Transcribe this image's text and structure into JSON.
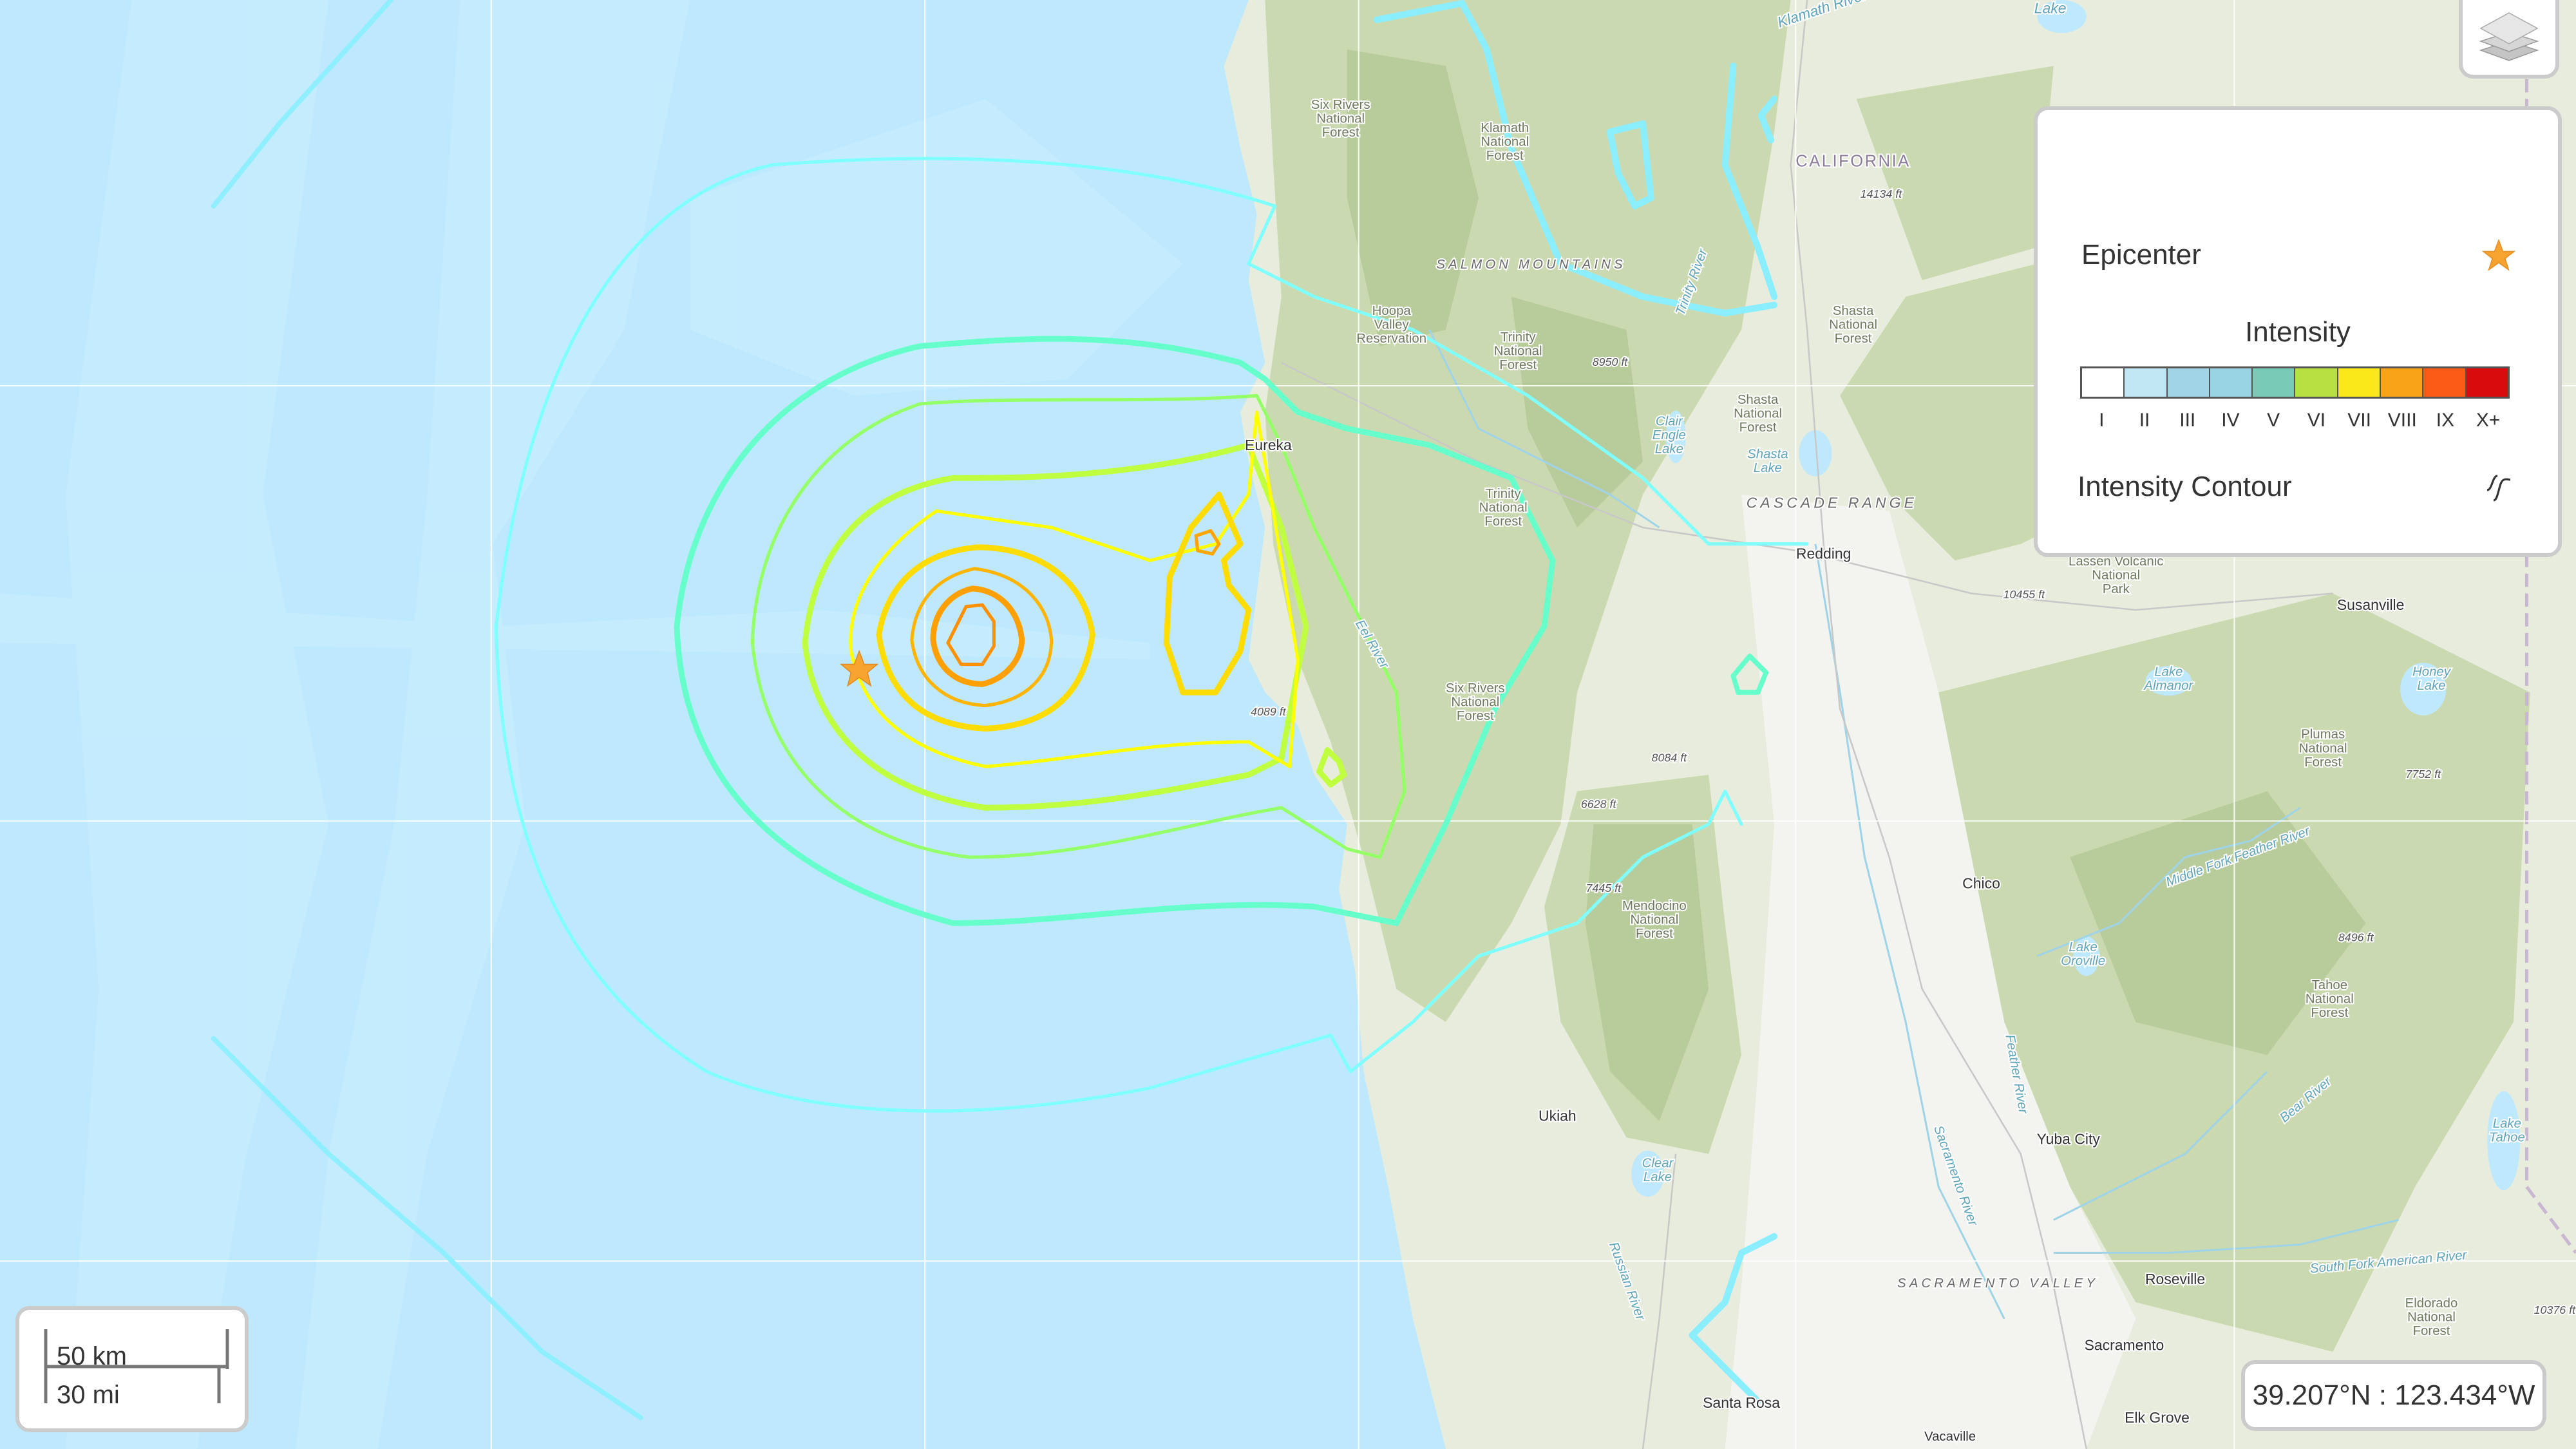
{
  "map": {
    "type": "USGS ShakeMap intensity contours",
    "epicenter": {
      "label": "Epicenter",
      "icon": "star-icon",
      "color": "#f7a330"
    },
    "contour_colors": {
      "III": "#a0e6ff",
      "IV": "#80ffff",
      "V": "#7affc8",
      "VI": "#b8ff40",
      "VI_5": "#ffff00",
      "VII": "#ffdc00",
      "VII_5": "#ffc000",
      "VIII": "#ff9900"
    },
    "place_labels": [
      {
        "text": "Klamath River",
        "kind": "river"
      },
      {
        "text": "Lake",
        "kind": "water"
      },
      {
        "text": "Six Rivers National Forest",
        "kind": "forest"
      },
      {
        "text": "Klamath National Forest",
        "kind": "forest"
      },
      {
        "text": "CALIFORNIA",
        "kind": "state"
      },
      {
        "text": "14134 ft",
        "kind": "elevation"
      },
      {
        "text": "SALMON MOUNTAINS",
        "kind": "range"
      },
      {
        "text": "Trinity River",
        "kind": "river"
      },
      {
        "text": "Hoopa Valley Reservation",
        "kind": "reservation"
      },
      {
        "text": "Trinity National Forest",
        "kind": "forest"
      },
      {
        "text": "8950 ft",
        "kind": "elevation"
      },
      {
        "text": "Shasta National Forest",
        "kind": "forest"
      },
      {
        "text": "Shasta National Forest",
        "kind": "forest"
      },
      {
        "text": "Eureka",
        "kind": "city"
      },
      {
        "text": "Clair Engle Lake",
        "kind": "water"
      },
      {
        "text": "Shasta Lake",
        "kind": "water"
      },
      {
        "text": "CASCADE RANGE",
        "kind": "range"
      },
      {
        "text": "Trinity National Forest",
        "kind": "forest"
      },
      {
        "text": "Redding",
        "kind": "city"
      },
      {
        "text": "Lassen Volcanic National Park",
        "kind": "park"
      },
      {
        "text": "10455 ft",
        "kind": "elevation"
      },
      {
        "text": "Susanville",
        "kind": "city"
      },
      {
        "text": "Lake Almanor",
        "kind": "water"
      },
      {
        "text": "Honey Lake",
        "kind": "water"
      },
      {
        "text": "Eel River",
        "kind": "river"
      },
      {
        "text": "4089 ft",
        "kind": "elevation"
      },
      {
        "text": "Six Rivers National Forest",
        "kind": "forest"
      },
      {
        "text": "Plumas National Forest",
        "kind": "forest"
      },
      {
        "text": "8084 ft",
        "kind": "elevation"
      },
      {
        "text": "7752 ft",
        "kind": "elevation"
      },
      {
        "text": "6628 ft",
        "kind": "elevation"
      },
      {
        "text": "Middle Fork Feather River",
        "kind": "river"
      },
      {
        "text": "7445 ft",
        "kind": "elevation"
      },
      {
        "text": "Chico",
        "kind": "city"
      },
      {
        "text": "Mendocino National Forest",
        "kind": "forest"
      },
      {
        "text": "8496 ft",
        "kind": "elevation"
      },
      {
        "text": "Lake Oroville",
        "kind": "water"
      },
      {
        "text": "Tahoe National Forest",
        "kind": "forest"
      },
      {
        "text": "Feather River",
        "kind": "river"
      },
      {
        "text": "Bear River",
        "kind": "river"
      },
      {
        "text": "Ukiah",
        "kind": "city"
      },
      {
        "text": "Lake Tahoe",
        "kind": "water"
      },
      {
        "text": "Yuba City",
        "kind": "city"
      },
      {
        "text": "Sacramento River",
        "kind": "river"
      },
      {
        "text": "Clear Lake",
        "kind": "water"
      },
      {
        "text": "Russian River",
        "kind": "river"
      },
      {
        "text": "SACRAMENTO VALLEY",
        "kind": "region"
      },
      {
        "text": "Roseville",
        "kind": "city"
      },
      {
        "text": "South Fork American River",
        "kind": "river"
      },
      {
        "text": "Eldorado National Forest",
        "kind": "forest"
      },
      {
        "text": "10376 ft",
        "kind": "elevation"
      },
      {
        "text": "Sacramento",
        "kind": "city"
      },
      {
        "text": "Santa Rosa",
        "kind": "city"
      },
      {
        "text": "Elk Grove",
        "kind": "city"
      },
      {
        "text": "Vacaville",
        "kind": "city"
      }
    ]
  },
  "layers_button": {
    "icon": "layers-icon"
  },
  "legend": {
    "epicenter_label": "Epicenter",
    "intensity_title": "Intensity",
    "intensity_scale": [
      {
        "label": "I",
        "color": "#ffffff"
      },
      {
        "label": "II",
        "color": "#bfe6f2"
      },
      {
        "label": "III",
        "color": "#a0d4e6"
      },
      {
        "label": "IV",
        "color": "#98d3e3"
      },
      {
        "label": "V",
        "color": "#78c9b6"
      },
      {
        "label": "VI",
        "color": "#b8e040"
      },
      {
        "label": "VII",
        "color": "#fbe81a"
      },
      {
        "label": "VIII",
        "color": "#f9a319"
      },
      {
        "label": "IX",
        "color": "#fa5a16"
      },
      {
        "label": "X+",
        "color": "#d80c0c"
      }
    ],
    "contour_label": "Intensity Contour"
  },
  "scale_bar": {
    "km": "50 km",
    "mi": "30 mi"
  },
  "coordinates": {
    "text": "39.207°N : 123.434°W"
  }
}
